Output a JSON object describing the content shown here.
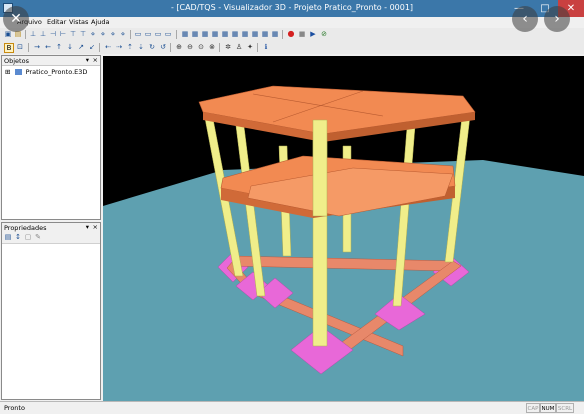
{
  "window": {
    "title": "- [CAD/TQS - Visualizador 3D - Projeto Pratico_Pronto - 0001]"
  },
  "menu": [
    "Arquivo",
    "Editar",
    "Vistas",
    "Ajuda"
  ],
  "panels": {
    "objects": {
      "title": "Objetos",
      "tree_item": "Pratico_Pronto.E3D",
      "expander": "⊞"
    },
    "properties": {
      "title": "Propriedades"
    }
  },
  "status": {
    "text": "Pronto",
    "indicators": [
      "CAP",
      "NUM",
      "SCRL"
    ]
  },
  "icons": {
    "close_overlay": "close-icon",
    "prev_overlay": "chevron-left-icon",
    "next_overlay": "chevron-right-icon"
  },
  "colors": {
    "slab": "#f28a52",
    "beam": "#e8886a",
    "column": "#f0ee8a",
    "footing": "#e868d8",
    "ground": "#5ea0b0",
    "background": "#000000",
    "title_bar": "#3b77a9"
  }
}
